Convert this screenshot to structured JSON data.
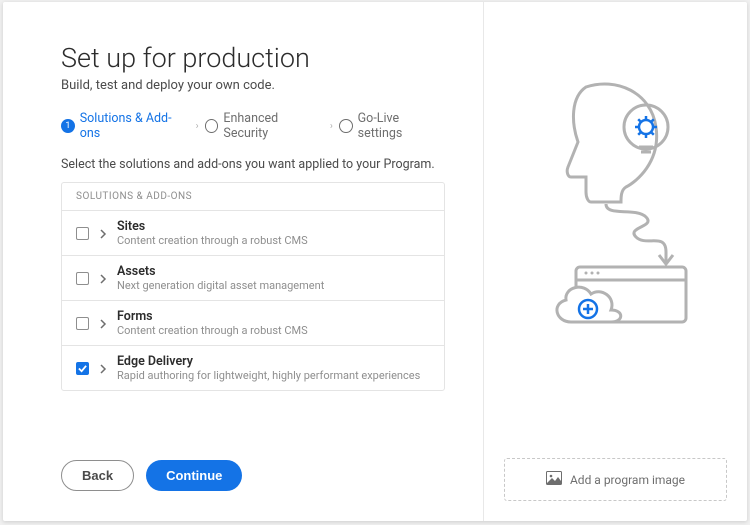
{
  "header": {
    "title": "Set up for production",
    "subtitle": "Build, test and deploy your own code."
  },
  "stepper": {
    "step1_num": "1",
    "step1_label": "Solutions & Add-ons",
    "step2_label": "Enhanced Security",
    "step3_label": "Go-Live settings"
  },
  "instruction": "Select the solutions and add-ons you want applied to your Program.",
  "list": {
    "header": "SOLUTIONS & ADD-ONS",
    "items": [
      {
        "title": "Sites",
        "desc": "Content creation through a robust CMS",
        "checked": false
      },
      {
        "title": "Assets",
        "desc": "Next generation digital asset management",
        "checked": false
      },
      {
        "title": "Forms",
        "desc": "Content creation through a robust CMS",
        "checked": false
      },
      {
        "title": "Edge Delivery",
        "desc": "Rapid authoring for lightweight, highly performant experiences",
        "checked": true
      }
    ]
  },
  "buttons": {
    "back": "Back",
    "continue": "Continue"
  },
  "upload": {
    "label": "Add a program image"
  }
}
